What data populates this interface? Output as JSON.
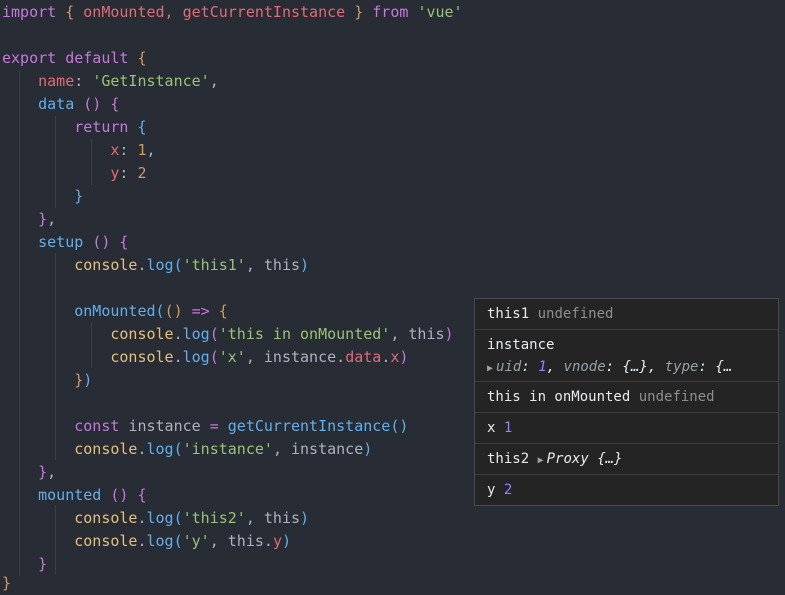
{
  "editor": {
    "line1": {
      "kw_import": "import",
      "brace_open": "{",
      "name1": "onMounted,",
      "name2": "getCurrentInstance",
      "brace_close": "}",
      "kw_from": "from",
      "module": "'vue'"
    },
    "line3": {
      "kw_export": "export",
      "kw_default": "default",
      "brace": "{"
    },
    "line4": {
      "key": "name",
      "colon": ":",
      "value": "'GetInstance'",
      "comma": ","
    },
    "line5": {
      "fn": "data",
      "parens": "()",
      "brace": "{"
    },
    "line6": {
      "kw_return": "return",
      "brace": "{"
    },
    "line7": {
      "key": "x",
      "colon": ":",
      "value": "1",
      "comma": ","
    },
    "line8": {
      "key": "y",
      "colon": ":",
      "value": "2"
    },
    "line9": {
      "brace": "}"
    },
    "line10": {
      "brace": "}",
      "comma": ","
    },
    "line11": {
      "fn": "setup",
      "parens": "()",
      "brace": "{"
    },
    "line12": {
      "obj": "console",
      "dot": ".",
      "fn": "log",
      "paren_open": "(",
      "arg1": "'this1'",
      "sep": ",",
      "arg2": "this",
      "paren_close": ")"
    },
    "line14": {
      "fn": "onMounted",
      "paren_open": "(",
      "inner_parens": "()",
      "arrow": "=>",
      "brace": "{"
    },
    "line15": {
      "obj": "console",
      "dot": ".",
      "fn": "log",
      "paren_open": "(",
      "arg1": "'this in onMounted'",
      "sep": ",",
      "arg2": "this",
      "paren_close": ")"
    },
    "line16": {
      "obj": "console",
      "dot": ".",
      "fn": "log",
      "paren_open": "(",
      "arg1": "'x'",
      "sep": ",",
      "arg2": "instance",
      "dot2": ".",
      "prop": "data",
      "dot3": ".",
      "prop2": "x",
      "paren_close": ")"
    },
    "line17": {
      "brace": "}",
      "paren_close": ")"
    },
    "line19": {
      "kw_const": "const",
      "var": "instance",
      "eq": "=",
      "fn": "getCurrentInstance",
      "parens": "()"
    },
    "line20": {
      "obj": "console",
      "dot": ".",
      "fn": "log",
      "paren_open": "(",
      "arg1": "'instance'",
      "sep": ",",
      "arg2": "instance",
      "paren_close": ")"
    },
    "line21": {
      "brace": "}",
      "comma": ","
    },
    "line22": {
      "fn": "mounted",
      "parens": "()",
      "brace": "{"
    },
    "line23": {
      "obj": "console",
      "dot": ".",
      "fn": "log",
      "paren_open": "(",
      "arg1": "'this2'",
      "sep": ",",
      "arg2": "this",
      "paren_close": ")"
    },
    "line24": {
      "obj": "console",
      "dot": ".",
      "fn": "log",
      "paren_open": "(",
      "arg1": "'y'",
      "sep": ",",
      "arg2": "this",
      "dot2": ".",
      "prop": "y",
      "paren_close": ")"
    },
    "line25": {
      "brace": "}"
    },
    "line26": {
      "brace": "}"
    }
  },
  "console": {
    "row1": {
      "label": "this1",
      "value": "undefined"
    },
    "row2": {
      "label": "instance",
      "tri": "▶",
      "k1": "uid",
      "c1": ":",
      "v1": "1",
      "s1": ",",
      "k2": "vnode",
      "c2": ":",
      "v2": "{…}",
      "s2": ",",
      "k3": "type",
      "c3": ":",
      "v3": "{…"
    },
    "row3": {
      "label": "this in onMounted",
      "value": "undefined"
    },
    "row4": {
      "label": "x",
      "value": "1"
    },
    "row5": {
      "label": "this2",
      "tri": "▶",
      "value": "Proxy {…}"
    },
    "row6": {
      "label": "y",
      "value": "2"
    }
  },
  "colors": {
    "background": "#282c34",
    "keyword": "#c678dd",
    "function": "#61afef",
    "string": "#98c379",
    "property": "#e06c75",
    "number": "#d19a66",
    "console_bg": "#242424",
    "console_number": "#9980ff"
  }
}
